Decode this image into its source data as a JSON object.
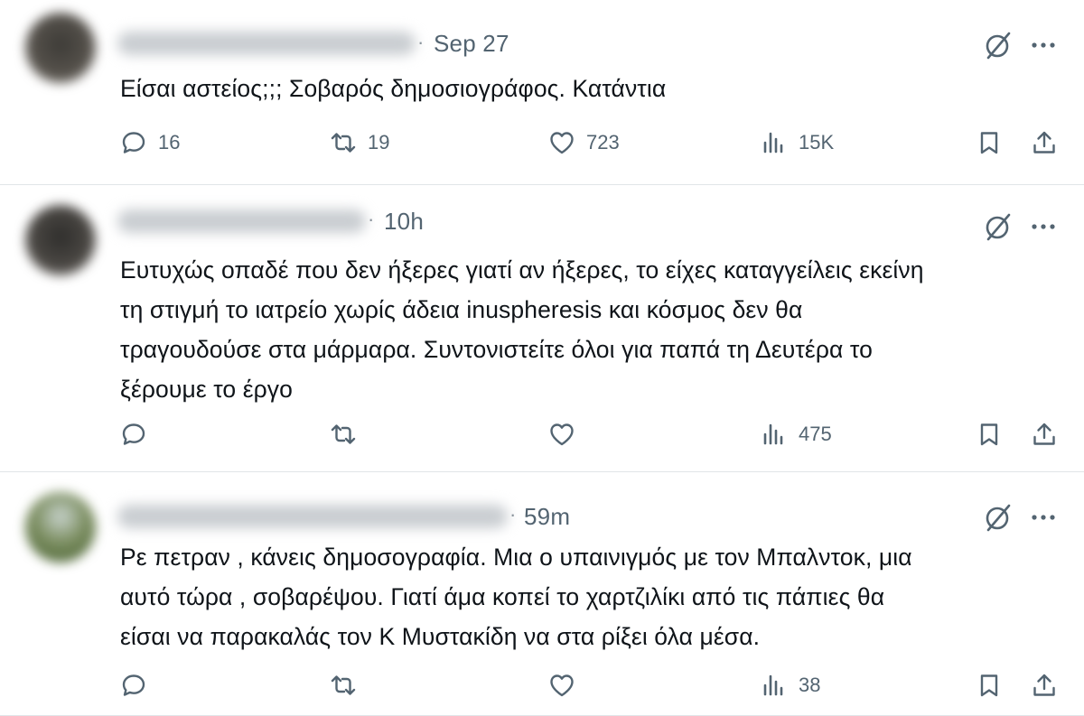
{
  "tweets": [
    {
      "time": "Sep 27",
      "lines": [
        "Είσαι αστείος;;; Σοβαρός δημοσιογράφος. Κατάντια"
      ],
      "stats": {
        "replies": "16",
        "reposts": "19",
        "likes": "723",
        "views": "15K"
      }
    },
    {
      "time": "10h",
      "lines": [
        "Ευτυχώς οπαδέ που δεν ήξερες γιατί αν ήξερες, το είχες καταγγείλεις εκείνη",
        "τη στιγμή το ιατρείο χωρίς άδεια inuspheresis και κόσμος δεν θα",
        "τραγουδούσε στα μάρμαρα. Συντονιστείτε όλοι για παπά τη Δευτέρα το",
        "ξέρουμε το έργο"
      ],
      "stats": {
        "replies": "",
        "reposts": "",
        "likes": "",
        "views": "475"
      }
    },
    {
      "time": "59m",
      "lines": [
        "Ρε πετραν , κάνεις δημοσογραφία. Μια ο υπαινιγμός με τον Μπαλντοκ, μια",
        "αυτό τώρα , σοβαρέψου. Γιατί άμα κοπεί το χαρτζιλίκι από τις πάπιες θα",
        "είσαι να παρακαλάς τον Κ Μυστακίδη να στα ρίξει όλα μέσα."
      ],
      "stats": {
        "replies": "",
        "reposts": "",
        "likes": "",
        "views": "38"
      }
    }
  ],
  "icons": [
    "grok-icon",
    "more-icon",
    "reply-icon",
    "repost-icon",
    "like-icon",
    "views-icon",
    "bookmark-icon",
    "share-icon"
  ],
  "colors": {
    "text": "#0f1419",
    "muted": "#536471",
    "divider": "#e1e5e8"
  }
}
